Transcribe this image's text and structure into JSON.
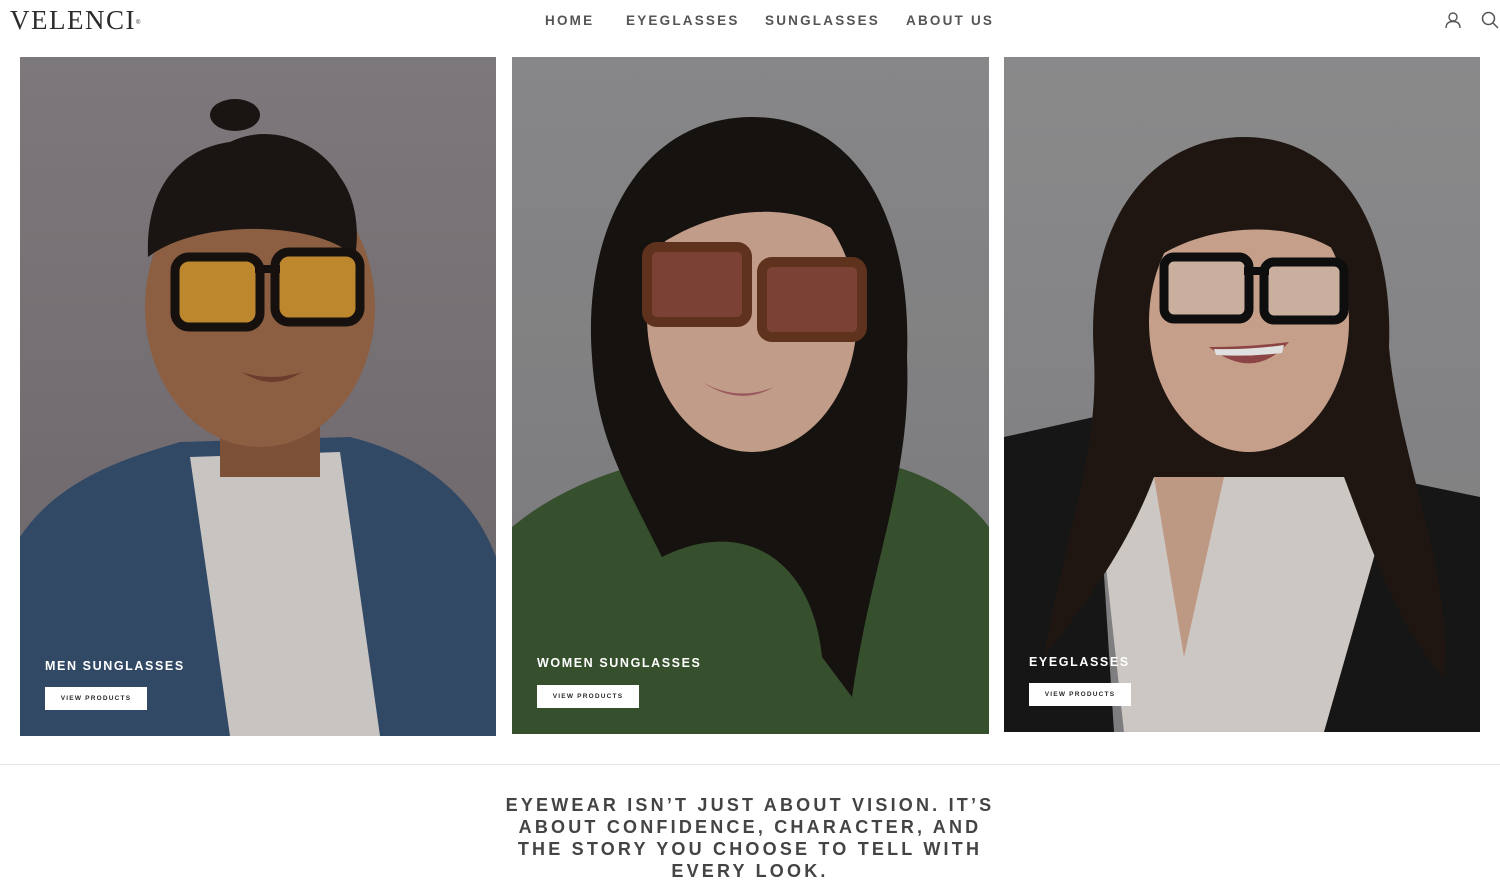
{
  "header": {
    "logo": "VELENCI",
    "logo_mark": "®",
    "nav": [
      "HOME",
      "EYEGLASSES",
      "SUNGLASSES",
      "ABOUT US"
    ],
    "icons": [
      "user-icon",
      "search-icon"
    ]
  },
  "cards": [
    {
      "title": "MEN SUNGLASSES",
      "button": "VIEW PRODUCTS",
      "subject": {
        "hair": "#1e1915",
        "skin": "#a06b4c",
        "lens": "#d79a34",
        "frame": "#1a1410",
        "top": "#3a5475",
        "inner": "#e6e3e0"
      }
    },
    {
      "title": "WOMEN SUNGLASSES",
      "button": "VIEW PRODUCTS",
      "subject": {
        "hair": "#1a1512",
        "skin": "#dcb39c",
        "lens": "#8c4b3c",
        "frame": "#6b3a20",
        "top": "#3e5a34",
        "inner": "#3e5a34"
      }
    },
    {
      "title": "EYEGLASSES",
      "button": "VIEW PRODUCTS",
      "subject": {
        "hair": "#241a14",
        "skin": "#e1b59c",
        "lens": "#e6c8b4",
        "frame": "#111111",
        "top": "#1a1a1a",
        "inner": "#ece6e0"
      }
    }
  ],
  "tagline": "EYEWEAR ISN’T JUST ABOUT VISION. IT’S ABOUT CONFIDENCE, CHARACTER, AND THE STORY YOU CHOOSE TO TELL WITH EVERY LOOK."
}
